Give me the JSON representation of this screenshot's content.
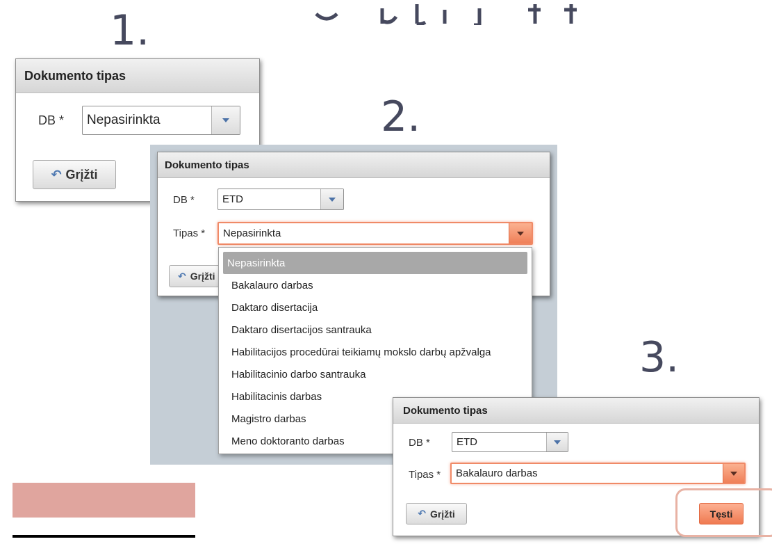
{
  "step_labels": [
    "1.",
    "2.",
    "3."
  ],
  "dialog1": {
    "title": "Dokumento tipas",
    "db_label": "DB *",
    "db_value": "Nepasirinkta",
    "back_label": "Grįžti"
  },
  "dialog2": {
    "title": "Dokumento tipas",
    "db_label": "DB *",
    "db_value": "ETD",
    "type_label": "Tipas *",
    "type_value": "Nepasirinkta",
    "back_label": "Grįžti",
    "options": [
      "Nepasirinkta",
      "Bakalauro darbas",
      "Daktaro disertacija",
      "Daktaro disertacijos santrauka",
      "Habilitacijos procedūrai teikiamų mokslo darbų apžvalga",
      "Habilitacinio darbo santrauka",
      "Habilitacinis darbas",
      "Magistro darbas",
      "Meno doktoranto darbas"
    ],
    "selected_option_index": 0
  },
  "dialog3": {
    "title": "Dokumento tipas",
    "db_label": "DB *",
    "db_value": "ETD",
    "type_label": "Tipas *",
    "type_value": "Bakalauro darbas",
    "back_label": "Grįžti",
    "continue_label": "Tęsti"
  },
  "colors": {
    "accent_orange": "#ef7a51",
    "step_label": "#46495e",
    "backdrop_blue_grey": "#c5ced6",
    "pink_block": "#e0a59e"
  },
  "icons": {
    "back": "undo-arrow-icon",
    "dropdown": "triangle-down-icon"
  }
}
